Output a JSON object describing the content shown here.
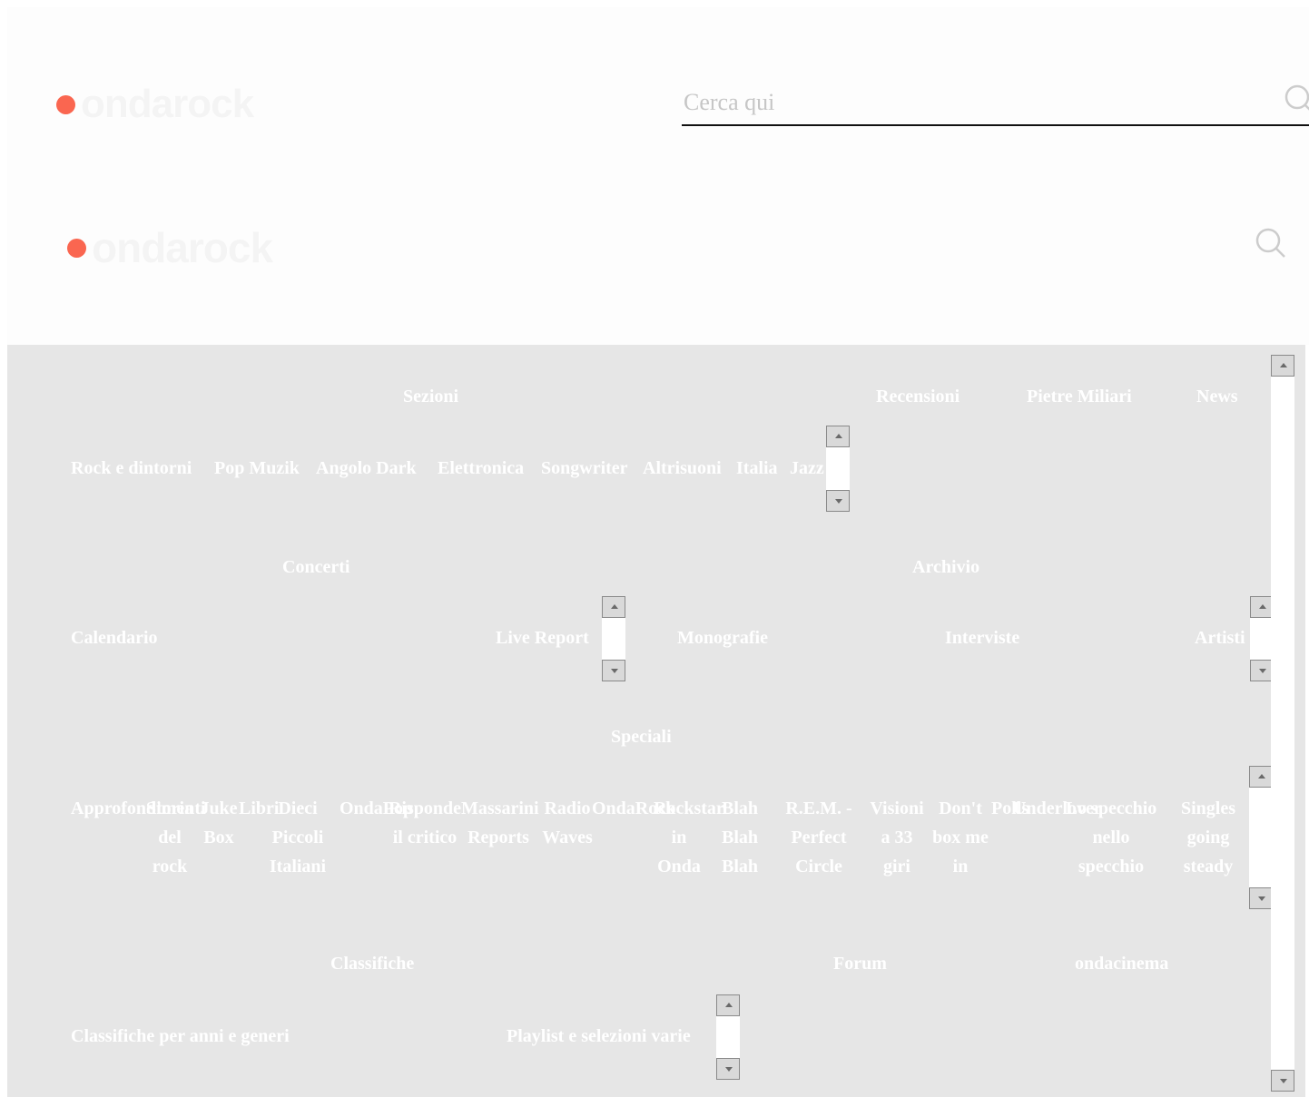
{
  "brand": {
    "name": "ondarock",
    "accent_color": "#fa6650"
  },
  "search": {
    "placeholder": "Cerca qui",
    "value": ""
  },
  "menu": {
    "top_links": [
      "Sezioni",
      "Recensioni",
      "Pietre Miliari",
      "News"
    ],
    "sezioni_items": [
      "Rock e dintorni",
      "Pop Muzik",
      "Angolo Dark",
      "Elettronica",
      "Songwriter",
      "Altrisuoni",
      "Italia",
      "Jazz"
    ],
    "concerti_label": "Concerti",
    "archivio_label": "Archivio",
    "concerti_items": [
      "Calendario",
      "Live Report"
    ],
    "archivio_items": [
      "Monografie",
      "Interviste",
      "Artisti"
    ],
    "speciali_label": "Speciali",
    "speciali_items": [
      "Approfondimenti",
      "Storia del rock",
      "Juke Box",
      "Libri",
      "Dieci Piccoli Italiani",
      "OndaPop",
      "Risponde il critico",
      "Massarini Reports",
      "Radio Waves",
      "OndaRock",
      "Rockstar in Onda",
      "Blah Blah Blah",
      "R.E.M. - Perfect Circle",
      "Visioni a 33 giri",
      "Don't box me in",
      "Polls",
      "Underlover",
      "Lo specchio nello specchio",
      "Singles going steady"
    ],
    "classifiche_label": "Classifiche",
    "forum_label": "Forum",
    "ondacinema_label": "ondacinema",
    "classifiche_items": [
      "Classifiche per anni e generi",
      "Playlist e selezioni varie"
    ]
  }
}
